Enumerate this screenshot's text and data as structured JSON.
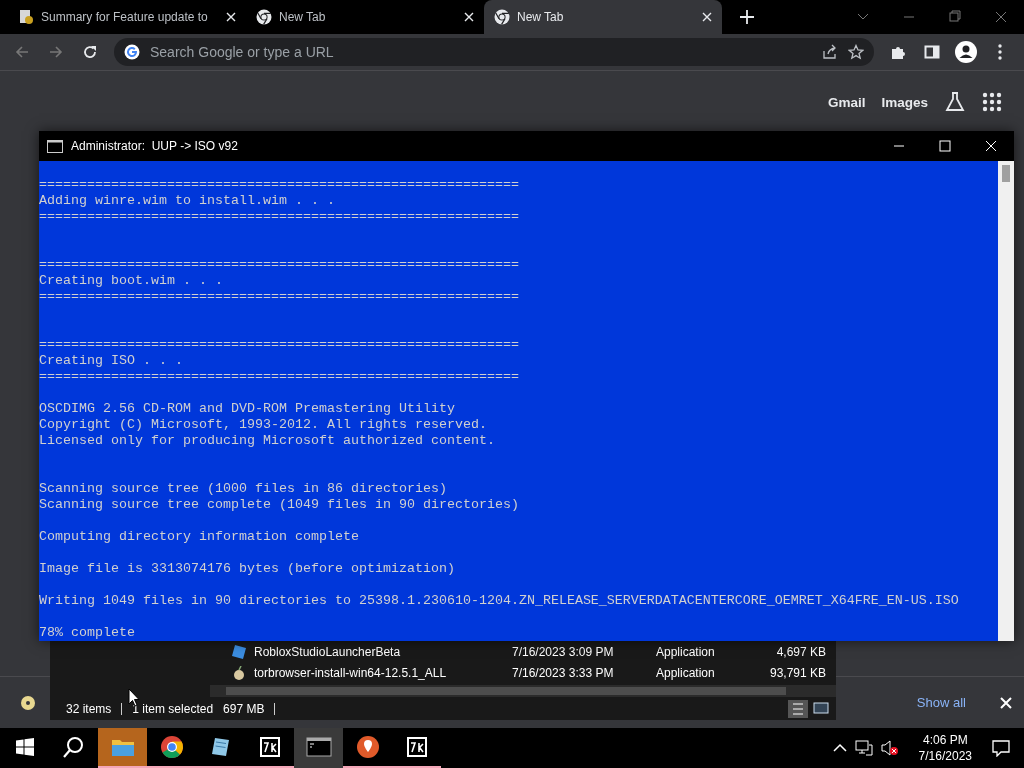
{
  "browser": {
    "tabs": [
      {
        "title": "Summary for Feature update to",
        "selected": false,
        "kind": "document"
      },
      {
        "title": "New Tab",
        "selected": false,
        "kind": "newtab"
      },
      {
        "title": "New Tab",
        "selected": true,
        "kind": "newtab"
      }
    ],
    "address_bar": {
      "placeholder": "Search Google or type a URL"
    },
    "ntp_links": [
      "Gmail",
      "Images"
    ]
  },
  "console_window": {
    "title": "Administrator:  UUP -> ISO v92",
    "lines": [
      {
        "kind": "blank"
      },
      {
        "kind": "text",
        "text": "============================================================"
      },
      {
        "kind": "text",
        "text": "Adding winre.wim to install.wim . . ."
      },
      {
        "kind": "text",
        "text": "============================================================"
      },
      {
        "kind": "blank"
      },
      {
        "kind": "blank"
      },
      {
        "kind": "text",
        "text": "============================================================"
      },
      {
        "kind": "text",
        "text": "Creating boot.wim . . ."
      },
      {
        "kind": "text",
        "text": "============================================================"
      },
      {
        "kind": "blank"
      },
      {
        "kind": "blank"
      },
      {
        "kind": "text",
        "text": "============================================================"
      },
      {
        "kind": "text",
        "text": "Creating ISO . . ."
      },
      {
        "kind": "text",
        "text": "============================================================"
      },
      {
        "kind": "blank"
      },
      {
        "kind": "text",
        "text": "OSCDIMG 2.56 CD-ROM and DVD-ROM Premastering Utility"
      },
      {
        "kind": "text",
        "text": "Copyright (C) Microsoft, 1993-2012. All rights reserved."
      },
      {
        "kind": "text",
        "text": "Licensed only for producing Microsoft authorized content."
      },
      {
        "kind": "blank"
      },
      {
        "kind": "blank"
      },
      {
        "kind": "text",
        "text": "Scanning source tree (1000 files in 86 directories)"
      },
      {
        "kind": "text",
        "text": "Scanning source tree complete (1049 files in 90 directories)"
      },
      {
        "kind": "blank"
      },
      {
        "kind": "text",
        "text": "Computing directory information complete"
      },
      {
        "kind": "blank"
      },
      {
        "kind": "text",
        "text": "Image file is 3313074176 bytes (before optimization)"
      },
      {
        "kind": "blank"
      },
      {
        "kind": "text",
        "text": "Writing 1049 files in 90 directories to 25398.1.230610-1204.ZN_RELEASE_SERVERDATACENTERCORE_OEMRET_X64FRE_EN-US.ISO"
      },
      {
        "kind": "blank"
      },
      {
        "kind": "text",
        "text": "78% complete"
      }
    ]
  },
  "explorer": {
    "rows": [
      {
        "name": "RobloxStudioLauncherBeta",
        "date": "7/16/2023 3:09 PM",
        "type": "Application",
        "size": "4,697 KB",
        "kind": "studio"
      },
      {
        "name": "torbrowser-install-win64-12.5.1_ALL",
        "date": "7/16/2023 3:33 PM",
        "type": "Application",
        "size": "93,791 KB",
        "kind": "installer"
      }
    ],
    "status": {
      "items": "32 items",
      "selection": "1 item selected",
      "size": "697 MB"
    }
  },
  "downloads_bar": {
    "show_all": "Show all"
  },
  "taskbar": {
    "apps": [
      {
        "kind": "explorer",
        "active": true,
        "open": true
      },
      {
        "kind": "chrome",
        "active": false,
        "open": true
      },
      {
        "kind": "notepad",
        "active": false,
        "open": true
      },
      {
        "kind": "sevenzip",
        "active": false,
        "open": true
      },
      {
        "kind": "terminal",
        "active": true,
        "open": false
      },
      {
        "kind": "maps",
        "active": false,
        "open": true
      },
      {
        "kind": "sevenzip",
        "active": false,
        "open": true
      }
    ],
    "clock": {
      "time": "4:06 PM",
      "date": "7/16/2023"
    }
  }
}
